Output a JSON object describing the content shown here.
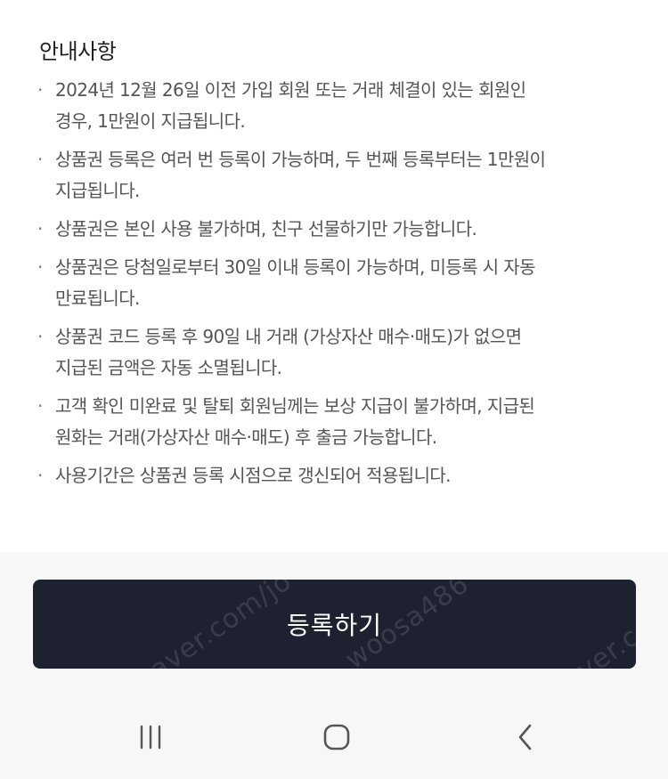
{
  "notice": {
    "title": "안내사항",
    "bullet": "·",
    "items": [
      {
        "lines": [
          "2024년 12월 26일 이전 가입 회원 또는 거래 체결이 있는 회원인",
          "경우, 1만원이 지급됩니다."
        ]
      },
      {
        "lines": [
          "상품권 등록은 여러 번 등록이 가능하며, 두 번째 등록부터는 1만원이",
          "지급됩니다."
        ]
      },
      {
        "lines": [
          "상품권은 본인 사용 불가하며, 친구 선물하기만 가능합니다."
        ]
      },
      {
        "lines": [
          "상품권은 당첨일로부터 30일 이내 등록이 가능하며, 미등록 시 자동",
          "만료됩니다."
        ]
      },
      {
        "lines": [
          "상품권 코드 등록 후 90일 내 거래 (가상자산 매수·매도)가 없으면",
          "지급된 금액은 자동 소멸됩니다."
        ]
      },
      {
        "lines": [
          "고객 확인 미완료 및 탈퇴 회원님께는 보상 지급이 불가하며, 지급된",
          "원화는 거래(가상자산 매수·매도) 후 출금 가능합니다."
        ]
      },
      {
        "lines": [
          "사용기간은 상품권 등록 시점으로 갱신되어 적용됩니다."
        ]
      }
    ]
  },
  "register_button": {
    "label": "등록하기",
    "bg_color": "#1e2130"
  },
  "watermarks": [
    "naver.com/jo",
    "woosa486",
    "naver.com/joon"
  ],
  "nav_bar": {
    "recent_icon": "recent-apps-icon",
    "home_icon": "home-icon",
    "back_icon": "back-icon"
  }
}
